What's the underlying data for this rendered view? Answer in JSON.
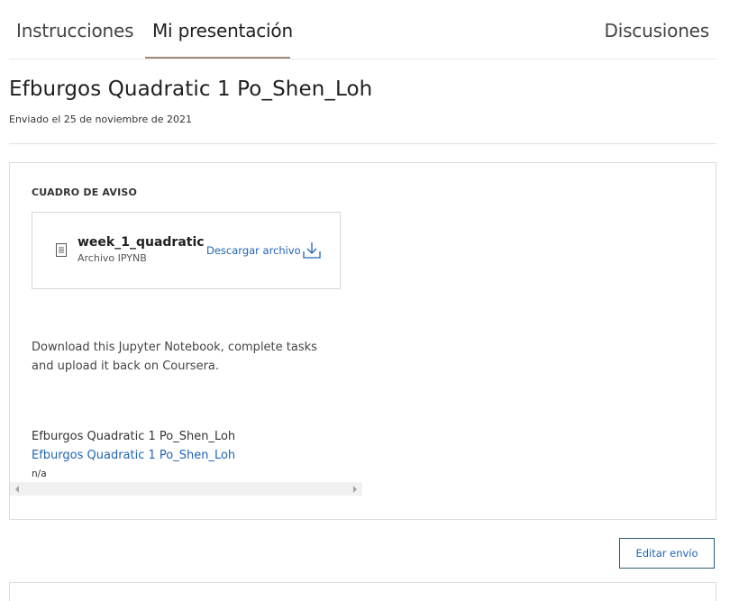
{
  "tabs": [
    {
      "label": "Instrucciones"
    },
    {
      "label": "Mi presentación"
    },
    {
      "label": "Discusiones"
    }
  ],
  "submission": {
    "title": "Efburgos Quadratic 1 Po_Shen_Loh",
    "date_text": "Enviado el 25 de noviembre de 2021"
  },
  "notice": {
    "heading": "CUADRO DE AVISO",
    "file": {
      "name": "week_1_quadratic",
      "type": "Archivo IPYNB",
      "download_label": "Descargar archivo",
      "icon": "document-icon"
    },
    "description": "Download this Jupyter Notebook, complete tasks and upload it back on Coursera.",
    "lines": {
      "plain": "Efburgos Quadratic 1 Po_Shen_Loh",
      "link": "Efburgos Quadratic 1 Po_Shen_Loh",
      "small": "n/a"
    }
  },
  "actions": {
    "edit_label": "Editar envío"
  },
  "colors": {
    "accent_link": "#1f64b5",
    "tab_underline": "#a08c74",
    "button_border": "#2a5d75"
  }
}
